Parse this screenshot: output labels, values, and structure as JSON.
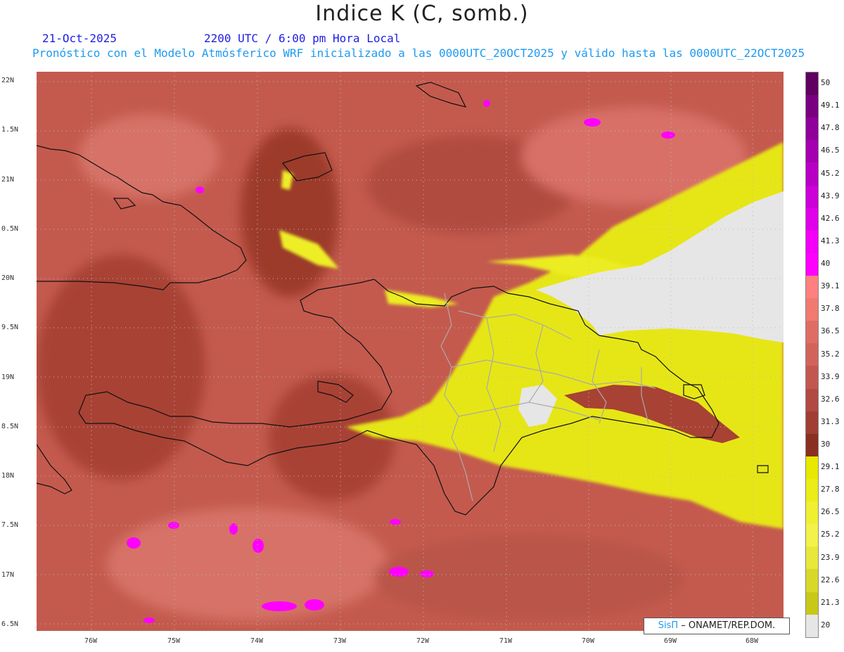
{
  "title": "Indice K (C, somb.)",
  "date": "21-Oct-2025",
  "time": "2200 UTC / 6:00 pm Hora Local",
  "description": "Pronóstico con el Modelo Atmósferico WRF inicializado a las 0000UTC_20OCT2025 y válido hasta las  0000UTC_22OCT2025",
  "lat_labels": [
    "22N",
    "1.5N",
    "21N",
    "0.5N",
    "20N",
    "9.5N",
    "19N",
    "8.5N",
    "18N",
    "7.5N",
    "17N",
    "6.5N"
  ],
  "lon_labels": [
    "76W",
    "75W",
    "74W",
    "73W",
    "72W",
    "71W",
    "70W",
    "69W",
    "68W"
  ],
  "legend": {
    "labels": [
      "50",
      "49.1",
      "47.8",
      "46.5",
      "45.2",
      "43.9",
      "42.6",
      "41.3",
      "40",
      "39.1",
      "37.8",
      "36.5",
      "35.2",
      "33.9",
      "32.6",
      "31.3",
      "30",
      "29.1",
      "27.8",
      "26.5",
      "25.2",
      "23.9",
      "22.6",
      "21.3",
      "20"
    ],
    "colors": [
      "#600060",
      "#7a0080",
      "#90009a",
      "#a400b0",
      "#b800c4",
      "#cc00d8",
      "#e000ea",
      "#f400f8",
      "#ff00ff",
      "#ff8080",
      "#f07a70",
      "#e06d64",
      "#d2635a",
      "#c45650",
      "#b04a42",
      "#a03e34",
      "#8a3020",
      "#e8e800",
      "#ecec18",
      "#f0f030",
      "#f2f24a",
      "#e8e83a",
      "#d8d828",
      "#c8c818",
      "#e6e6e6"
    ]
  },
  "credit": {
    "brand": "SisΠ",
    "text": " – ONAMET/REP.DOM."
  }
}
